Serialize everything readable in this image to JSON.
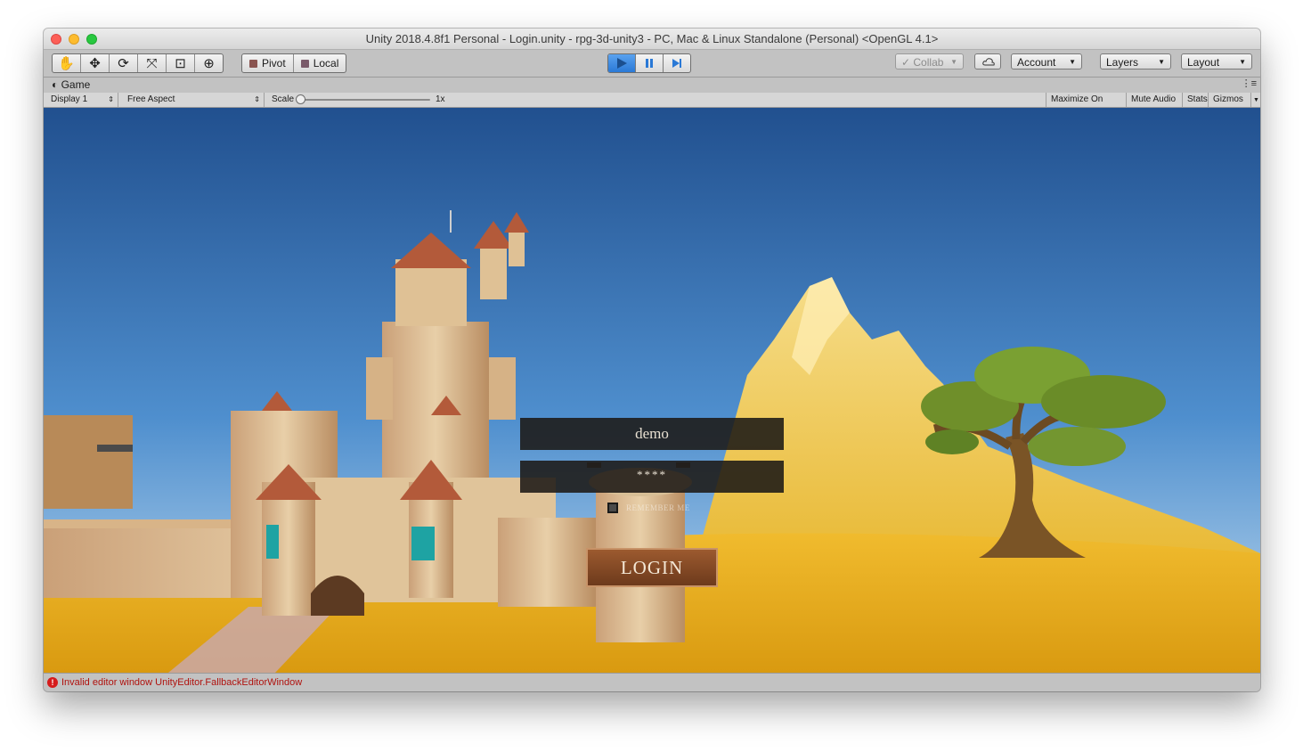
{
  "window": {
    "title": "Unity 2018.4.8f1 Personal - Login.unity - rpg-3d-unity3 - PC, Mac & Linux Standalone (Personal) <OpenGL 4.1>"
  },
  "toolbar": {
    "tools": [
      "hand-icon",
      "move-icon",
      "rotate-icon",
      "scale-icon",
      "rect-icon",
      "transform-icon"
    ],
    "pivot_label": "Pivot",
    "local_label": "Local",
    "collab_label": "Collab",
    "account_label": "Account",
    "layers_label": "Layers",
    "layout_label": "Layout"
  },
  "game_tab": {
    "label": "Game",
    "display": "Display 1",
    "aspect": "Free Aspect",
    "scale_label": "Scale",
    "scale_value": "1x",
    "maximize_on_play": "Maximize On Play",
    "mute_audio": "Mute Audio",
    "stats": "Stats",
    "gizmos": "Gizmos"
  },
  "login": {
    "username_value": "demo",
    "password_value": "****",
    "remember_label": "REMEMBER ME",
    "login_label": "LOGIN"
  },
  "status": {
    "message": "Invalid editor window UnityEditor.FallbackEditorWindow"
  },
  "colors": {
    "play_active": "#2a79d6",
    "error": "#b0120e",
    "login_button": "#8a4a25"
  }
}
